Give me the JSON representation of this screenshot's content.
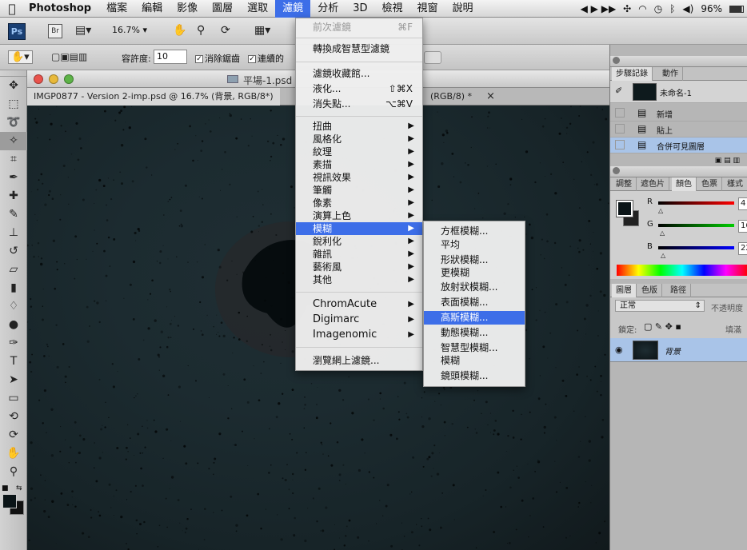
{
  "menubar": {
    "apple": "",
    "app": "Photoshop",
    "items": [
      "檔案",
      "編輯",
      "影像",
      "圖層",
      "選取",
      "濾鏡",
      "分析",
      "3D",
      "檢視",
      "視窗",
      "說明"
    ],
    "active_index": 5,
    "battery": "96%",
    "media": "◀ ▶ ▶▶"
  },
  "optbar": {
    "ps_logo": "Ps",
    "br_logo": "Br",
    "zoom": "16.7% ▾",
    "tolerance_label": "容許度:",
    "tolerance_value": "10",
    "antialias_label": "消除鋸齒",
    "contiguous_label": "連續的"
  },
  "document": {
    "window_title": "平場-1.psd",
    "tab1": "IMGP0877 - Version 2-imp.psd @ 16.7% (背景, RGB/8*)",
    "tab2": "(RGB/8) *",
    "tab_close": "×"
  },
  "filter_menu": {
    "last_filter": "前次濾鏡",
    "last_filter_shortcut": "⌘F",
    "smart": "轉換成智慧型濾鏡",
    "gallery": "濾鏡收藏館...",
    "liquify": "液化...",
    "liquify_shortcut": "⇧⌘X",
    "vanish": "消失點...",
    "vanish_shortcut": "⌥⌘V",
    "groups": [
      "扭曲",
      "風格化",
      "紋理",
      "素描",
      "視訊效果",
      "筆觸",
      "像素",
      "演算上色",
      "模糊",
      "銳利化",
      "雜訊",
      "藝術風",
      "其他"
    ],
    "plugins": [
      "ChromAcute",
      "Digimarc",
      "Imagenomic"
    ],
    "browse": "瀏覽網上濾鏡..."
  },
  "blur_submenu": {
    "items": [
      "方框模糊...",
      "平均",
      "形狀模糊...",
      "更模糊",
      "放射狀模糊...",
      "表面模糊...",
      "高斯模糊...",
      "動態模糊...",
      "智慧型模糊...",
      "模糊",
      "鏡頭模糊..."
    ],
    "highlight_index": 6
  },
  "history": {
    "tabs": [
      "步驟記錄",
      "動作"
    ],
    "snapshot": "未命名-1",
    "steps": [
      "新增",
      "貼上",
      "合併可見圖層"
    ]
  },
  "color": {
    "tabs": [
      "調整",
      "遮色片",
      "顏色",
      "色票",
      "樣式"
    ],
    "r_label": "R",
    "g_label": "G",
    "b_label": "B",
    "r_value": "4",
    "g_value": "16",
    "b_value": "22"
  },
  "layers": {
    "tabs": [
      "圖層",
      "色版",
      "路徑"
    ],
    "blend": "正常",
    "opacity_label": "不透明度",
    "lock_label": "鎖定:",
    "fill_label": "填滿",
    "layer_name": "背景"
  },
  "colors": {
    "accent": "#3d6ee8",
    "canvas": "#1c2b30"
  }
}
